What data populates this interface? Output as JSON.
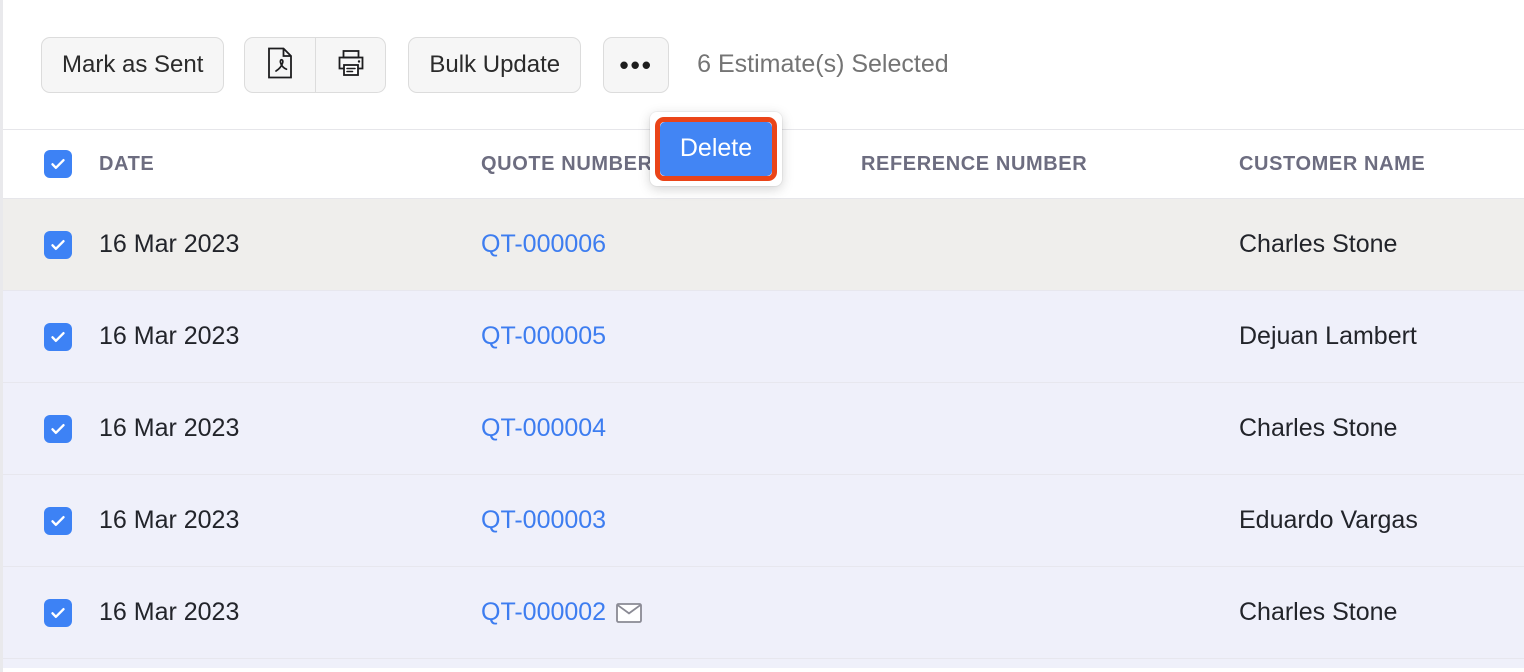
{
  "toolbar": {
    "mark_as_sent_label": "Mark as Sent",
    "pdf_icon": "pdf-file-icon",
    "print_icon": "printer-icon",
    "bulk_update_label": "Bulk Update",
    "more_label": "•••",
    "selection_status": "6 Estimate(s) Selected"
  },
  "dropdown": {
    "items": [
      {
        "label": "Delete",
        "highlighted": true
      }
    ],
    "highlight_color": "#ea4418",
    "item_bg_color": "#4285f4"
  },
  "table": {
    "headers": {
      "select_all": "select-all-checkbox",
      "date": "DATE",
      "quote_number": "QUOTE NUMBER",
      "reference_number": "REFERENCE NUMBER",
      "customer_name": "CUSTOMER NAME"
    },
    "rows": [
      {
        "checked": true,
        "date": "16 Mar 2023",
        "quote_number": "QT-000006",
        "reference_number": "",
        "customer_name": "Charles Stone",
        "has_mail_icon": false,
        "state": "hover"
      },
      {
        "checked": true,
        "date": "16 Mar 2023",
        "quote_number": "QT-000005",
        "reference_number": "",
        "customer_name": "Dejuan Lambert",
        "has_mail_icon": false,
        "state": "selected"
      },
      {
        "checked": true,
        "date": "16 Mar 2023",
        "quote_number": "QT-000004",
        "reference_number": "",
        "customer_name": "Charles Stone",
        "has_mail_icon": false,
        "state": "selected"
      },
      {
        "checked": true,
        "date": "16 Mar 2023",
        "quote_number": "QT-000003",
        "reference_number": "",
        "customer_name": "Eduardo Vargas",
        "has_mail_icon": false,
        "state": "selected"
      },
      {
        "checked": true,
        "date": "16 Mar 2023",
        "quote_number": "QT-000002",
        "reference_number": "",
        "customer_name": "Charles Stone",
        "has_mail_icon": true,
        "state": "selected"
      }
    ]
  },
  "colors": {
    "link": "#3d7df0",
    "checkbox": "#3d82f5",
    "row_selected": "#eff0fa",
    "row_hover": "#efeeec",
    "highlight_ring": "#ea4418"
  }
}
